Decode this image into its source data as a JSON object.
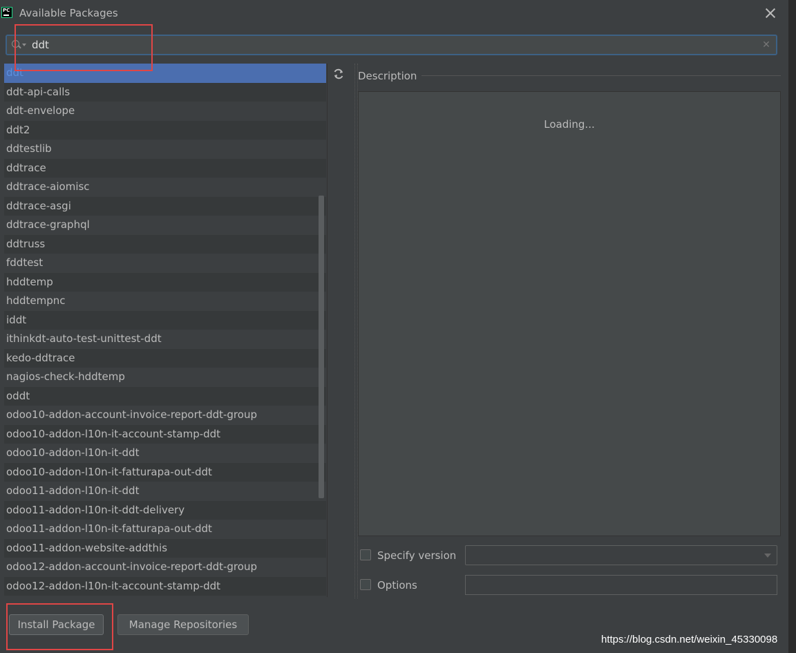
{
  "window": {
    "title": "Available Packages",
    "app_icon": "PC"
  },
  "search": {
    "value": "ddt",
    "icon": "search-icon"
  },
  "packages": [
    "ddt",
    "ddt-api-calls",
    "ddt-envelope",
    "ddt2",
    "ddtestlib",
    "ddtrace",
    "ddtrace-aiomisc",
    "ddtrace-asgi",
    "ddtrace-graphql",
    "ddtruss",
    "fddtest",
    "hddtemp",
    "hddtempnc",
    "iddt",
    "ithinkdt-auto-test-unittest-ddt",
    "kedo-ddtrace",
    "nagios-check-hddtemp",
    "oddt",
    "odoo10-addon-account-invoice-report-ddt-group",
    "odoo10-addon-l10n-it-account-stamp-ddt",
    "odoo10-addon-l10n-it-ddt",
    "odoo10-addon-l10n-it-fatturapa-out-ddt",
    "odoo11-addon-l10n-it-ddt",
    "odoo11-addon-l10n-it-ddt-delivery",
    "odoo11-addon-l10n-it-fatturapa-out-ddt",
    "odoo11-addon-website-addthis",
    "odoo12-addon-account-invoice-report-ddt-group",
    "odoo12-addon-l10n-it-account-stamp-ddt"
  ],
  "selected_index": 0,
  "description": {
    "label": "Description",
    "loading": "Loading..."
  },
  "options": {
    "specify_version_label": "Specify version",
    "options_label": "Options"
  },
  "buttons": {
    "install": "Install Package",
    "manage": "Manage Repositories"
  },
  "watermark": "https://blog.csdn.net/weixin_45330098",
  "colors": {
    "selection": "#4b6eaf",
    "highlight": "#e04646",
    "background": "#3c3f41"
  }
}
